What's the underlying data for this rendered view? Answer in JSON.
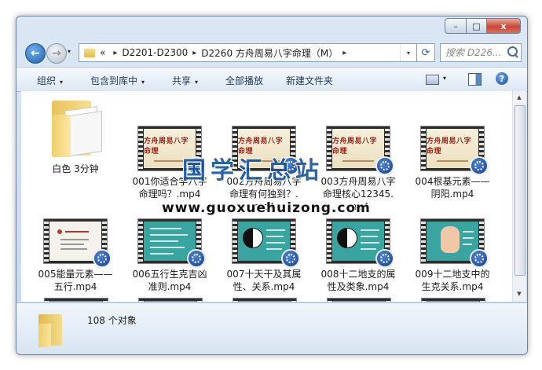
{
  "window": {
    "caption": {
      "minimize": "–",
      "maximize": "□",
      "close": "x"
    }
  },
  "nav": {
    "back_glyph": "←",
    "forward_glyph": "→",
    "history_glyph": "▾"
  },
  "address": {
    "overflow": "«",
    "crumbs": [
      "D2201-D2300",
      "D2260 方舟周易八字命理（M）"
    ],
    "chevron": "▸",
    "dropdown_glyph": "▾",
    "refresh_glyph": "⟳"
  },
  "search": {
    "placeholder": "搜索 D226..."
  },
  "toolbar": {
    "organize": "组织",
    "include_in_library": "包含到库中",
    "share": "共享",
    "play_all": "全部播放",
    "new_folder": "新建文件夹",
    "dropdown_glyph": "▾",
    "help_glyph": "?"
  },
  "items": [
    {
      "label": "白色 3分钟",
      "kind": "folder"
    },
    {
      "label": "001你适合学八字命理吗？.mp4",
      "kind": "video",
      "thumb": "title",
      "thumb_title": "方舟周易八字命理"
    },
    {
      "label": "002方舟周易八字命理有何独到？.mp4",
      "kind": "video",
      "thumb": "title",
      "thumb_title": "方舟周易八字命理"
    },
    {
      "label": "003方舟周易八字命理核心12345.mp4",
      "kind": "video",
      "thumb": "title",
      "thumb_title": "方舟周易八字命理"
    },
    {
      "label": "004根基元素——阴阳.mp4",
      "kind": "video",
      "thumb": "title",
      "thumb_title": "方舟周易八字命理"
    },
    {
      "label": "005能量元素——五行.mp4",
      "kind": "video",
      "thumb": "light"
    },
    {
      "label": "006五行生克吉凶准则.mp4",
      "kind": "video",
      "thumb": "teal"
    },
    {
      "label": "007十天干及其属性、关系.mp4",
      "kind": "video",
      "thumb": "yinyang"
    },
    {
      "label": "008十二地支的属性及类象.mp4",
      "kind": "video",
      "thumb": "yinyang"
    },
    {
      "label": "009十二地支中的生克关系.mp4",
      "kind": "video",
      "thumb": "hand"
    }
  ],
  "status": {
    "count": "108 个对象"
  },
  "watermark": {
    "title": "国学汇总站",
    "url": "www.guoxuehuizong.com"
  },
  "colors": {
    "accent": "#1e395b",
    "watermark": "#16539a",
    "teal_slide": "#3aa5a0",
    "title_red": "#9b2418"
  }
}
